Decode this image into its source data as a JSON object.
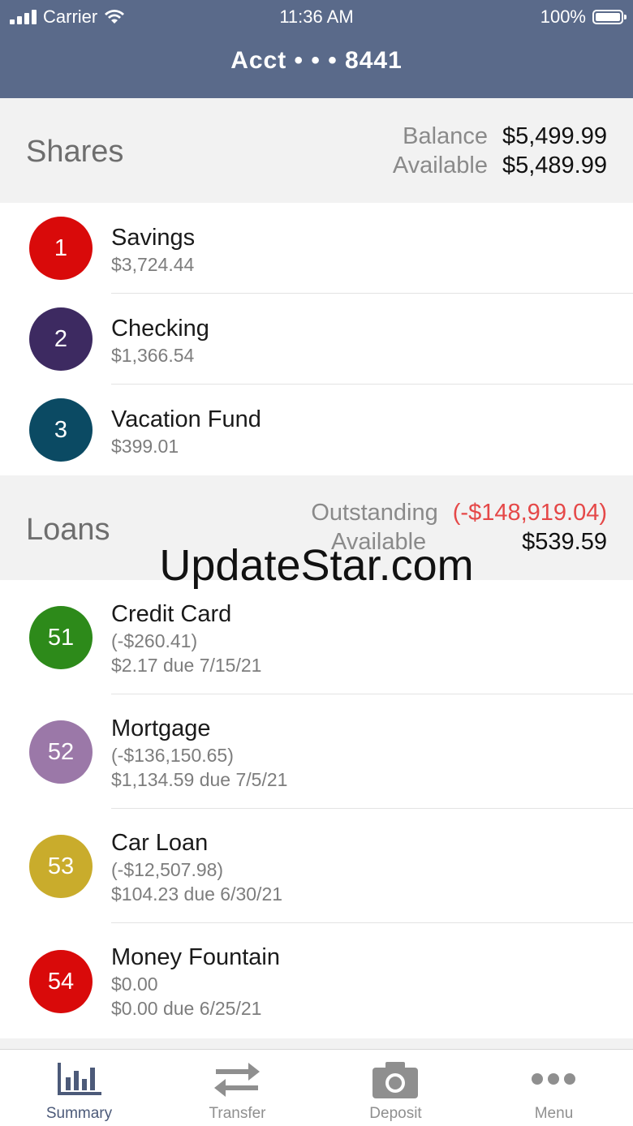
{
  "status_bar": {
    "carrier": "Carrier",
    "time": "11:36 AM",
    "battery": "100%"
  },
  "header": {
    "title": "Acct • • • 8441"
  },
  "shares": {
    "label": "Shares",
    "balance_label": "Balance",
    "balance_value": "$5,499.99",
    "available_label": "Available",
    "available_value": "$5,489.99",
    "items": [
      {
        "num": "1",
        "name": "Savings",
        "amount": "$3,724.44",
        "color": "#d90a0a"
      },
      {
        "num": "2",
        "name": "Checking",
        "amount": "$1,366.54",
        "color": "#3d2a61"
      },
      {
        "num": "3",
        "name": "Vacation Fund",
        "amount": "$399.01",
        "color": "#0b4a63"
      }
    ]
  },
  "loans": {
    "label": "Loans",
    "outstanding_label": "Outstanding",
    "outstanding_value": "(-$148,919.04)",
    "available_label": "Available",
    "available_value": "$539.59",
    "items": [
      {
        "num": "51",
        "name": "Credit Card",
        "amount": "(-$260.41)",
        "due": "$2.17 due 7/15/21",
        "color": "#2d8a1a"
      },
      {
        "num": "52",
        "name": "Mortgage",
        "amount": "(-$136,150.65)",
        "due": "$1,134.59 due 7/5/21",
        "color": "#9b78a8"
      },
      {
        "num": "53",
        "name": "Car Loan",
        "amount": "(-$12,507.98)",
        "due": "$104.23 due 6/30/21",
        "color": "#c9ac2c"
      },
      {
        "num": "54",
        "name": "Money Fountain",
        "amount": "$0.00",
        "due": "$0.00 due 6/25/21",
        "color": "#d90a0a"
      }
    ]
  },
  "watermark": "UpdateStar.com",
  "tabs": [
    {
      "label": "Summary",
      "icon": "bar-chart-icon",
      "active": true
    },
    {
      "label": "Transfer",
      "icon": "transfer-arrows-icon"
    },
    {
      "label": "Deposit",
      "icon": "camera-icon"
    },
    {
      "label": "Menu",
      "icon": "more-dots-icon"
    }
  ],
  "colors": {
    "header": "#5a6a8a",
    "negative": "#e54848",
    "tab_active": "#4c5a79",
    "tab_inactive": "#8f8f8f"
  }
}
